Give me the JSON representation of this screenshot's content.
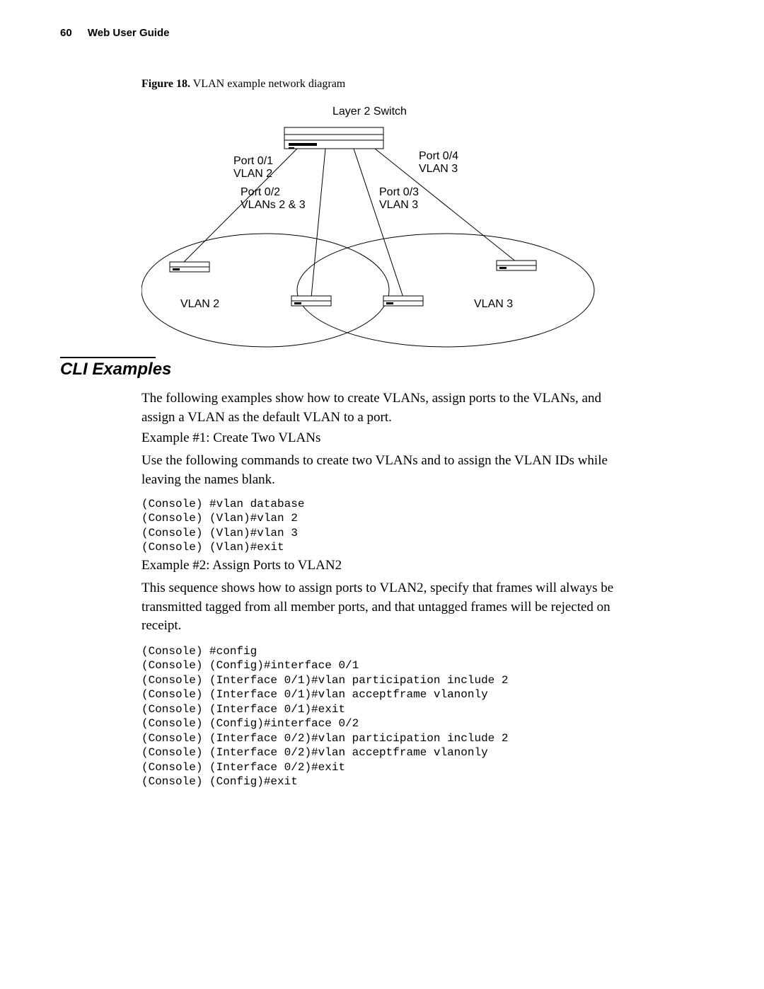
{
  "header": {
    "page_number": "60",
    "doc_title": "Web User Guide"
  },
  "figure": {
    "caption_lead": "Figure 18.",
    "caption_text": "VLAN example network diagram",
    "layer2_switch": "Layer 2 Switch",
    "port01_label": "Port 0/1",
    "port01_vlan": "VLAN 2",
    "port02_label": "Port 0/2",
    "port02_vlan": "VLANs 2 & 3",
    "port03_label": "Port 0/3",
    "port03_vlan": "VLAN 3",
    "port04_label": "Port 0/4",
    "port04_vlan": "VLAN 3",
    "left_ellipse_label": "VLAN 2",
    "right_ellipse_label": "VLAN 3"
  },
  "section": {
    "heading": "CLI Examples",
    "intro": "The following examples show how to create VLANs, assign ports to the VLANs, and assign a VLAN as the default VLAN to a port.",
    "ex1_title": "Example #1: Create Two VLANs",
    "ex1_desc": "Use the following commands to create two VLANs and to assign the VLAN IDs while leaving the names blank.",
    "ex1_code": "(Console) #vlan database\n(Console) (Vlan)#vlan 2\n(Console) (Vlan)#vlan 3\n(Console) (Vlan)#exit",
    "ex2_title": "Example #2: Assign Ports to VLAN2",
    "ex2_desc": "This sequence shows how to assign ports to VLAN2, specify that frames will always be transmitted tagged from all member ports, and that untagged frames will be rejected on receipt.",
    "ex2_code": "(Console) #config\n(Console) (Config)#interface 0/1\n(Console) (Interface 0/1)#vlan participation include 2\n(Console) (Interface 0/1)#vlan acceptframe vlanonly\n(Console) (Interface 0/1)#exit\n(Console) (Config)#interface 0/2\n(Console) (Interface 0/2)#vlan participation include 2\n(Console) (Interface 0/2)#vlan acceptframe vlanonly\n(Console) (Interface 0/2)#exit\n(Console) (Config)#exit"
  }
}
